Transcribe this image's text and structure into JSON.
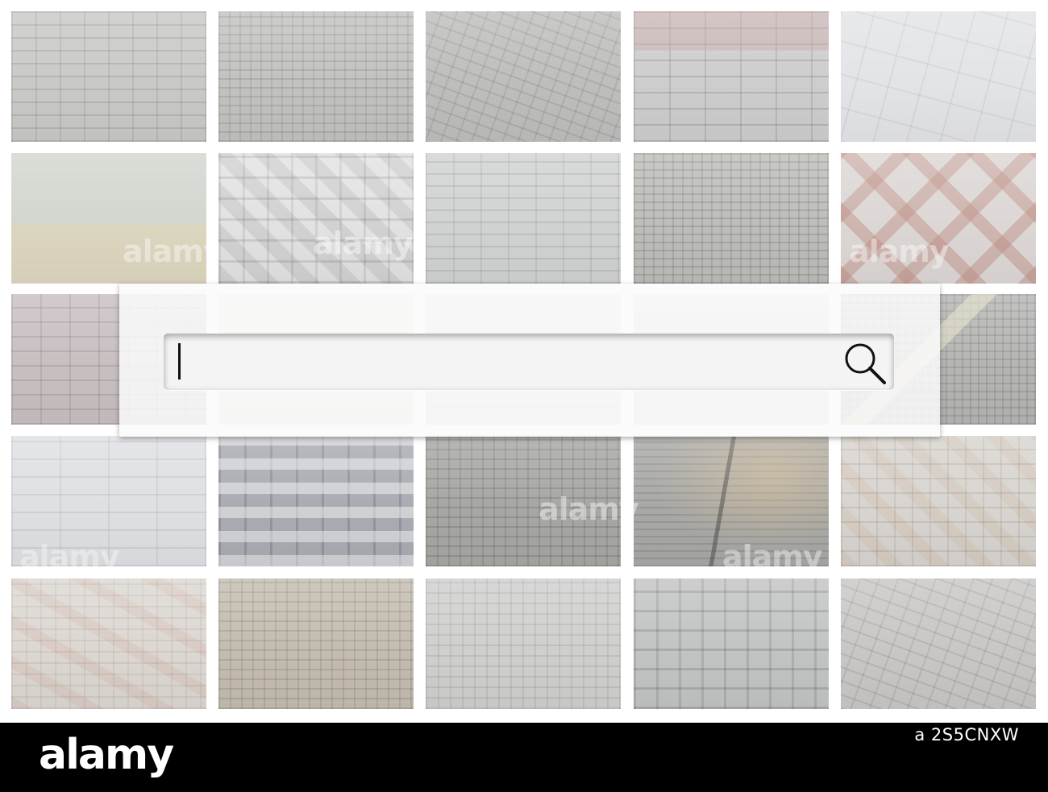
{
  "search": {
    "value": "",
    "placeholder": ""
  },
  "watermarks": [
    "alamy",
    "alamy",
    "alamy",
    "alamy",
    "alamy",
    "alamy"
  ],
  "footer": {
    "brand": "alamy",
    "image_id": "a    2S5CNXW"
  },
  "icons": [
    "search-icon"
  ]
}
